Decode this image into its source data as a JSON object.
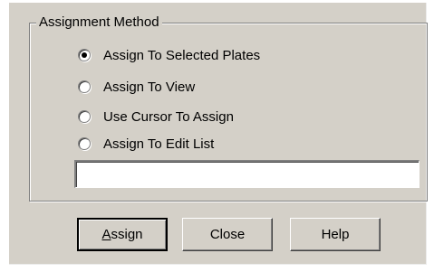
{
  "dialog": {
    "group_title": "Assignment Method",
    "options": [
      {
        "label": "Assign To Selected Plates",
        "selected": true
      },
      {
        "label": "Assign To View",
        "selected": false
      },
      {
        "label": "Use Cursor To Assign",
        "selected": false
      },
      {
        "label": "Assign To Edit List",
        "selected": false
      }
    ],
    "edit_list_value": "",
    "buttons": {
      "assign_accel": "A",
      "assign_rest": "ssign",
      "close": "Close",
      "help": "Help"
    }
  }
}
